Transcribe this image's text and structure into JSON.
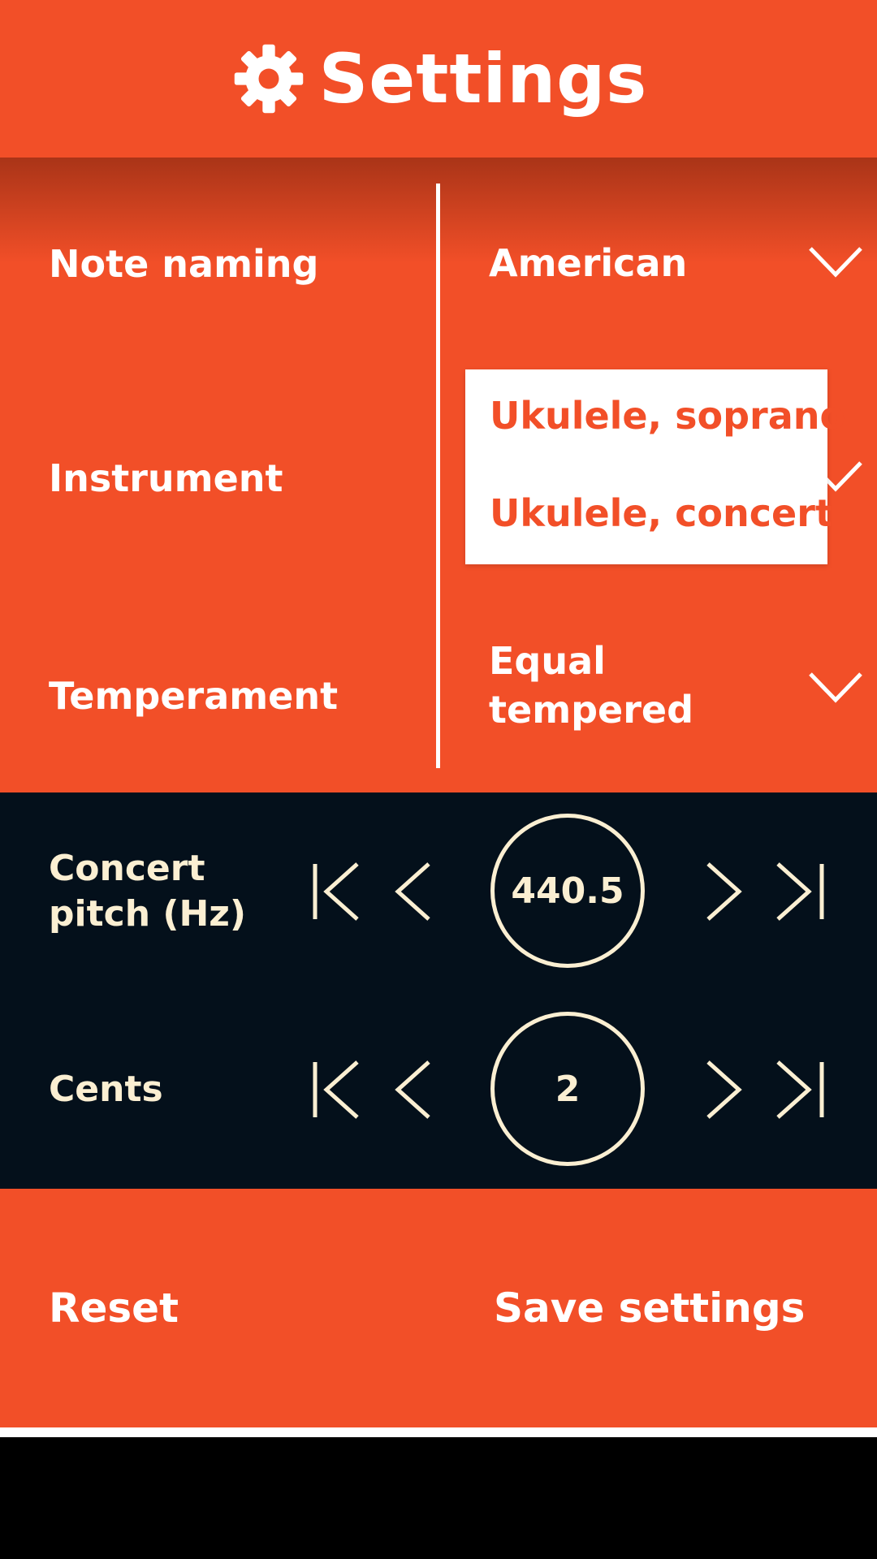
{
  "header": {
    "title": "Settings",
    "icon": "gear-icon"
  },
  "options": {
    "note_naming": {
      "label": "Note naming",
      "value": "American"
    },
    "instrument": {
      "label": "Instrument",
      "dropdown_items": [
        "Ukulele, soprano",
        "Ukulele, concert"
      ]
    },
    "temperament": {
      "label": "Temperament",
      "value_line1": "Equal",
      "value_line2": "tempered"
    }
  },
  "concert_pitch": {
    "label_line1": "Concert",
    "label_line2": "pitch (Hz)",
    "value": "440.5"
  },
  "cents": {
    "label": "Cents",
    "value": "2"
  },
  "footer": {
    "reset_label": "Reset",
    "save_label": "Save settings"
  },
  "colors": {
    "accent": "#F24F28",
    "dark": "#04101B",
    "cream": "#FBEFD2"
  }
}
